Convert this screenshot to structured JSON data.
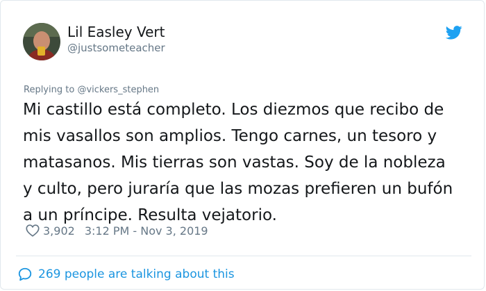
{
  "user": {
    "display_name": "Lil Easley Vert",
    "handle": "@justsometeacher"
  },
  "tweet": {
    "reply_prefix": "Replying to ",
    "reply_to": "@vickers_stephen",
    "lines": [
      "Mi castillo está completo. Los diezmos que recibo de",
      "mis vasallos son amplios. Tengo carnes, un tesoro y",
      "matasanos. Mis tierras son vastas. Soy de la nobleza",
      "y culto, pero juraría que las mozas prefieren un bufón",
      "a un príncipe. Resulta vejatorio."
    ],
    "likes": "3,902",
    "timestamp": "3:12 PM - Nov 3, 2019"
  },
  "footer": {
    "talking": "269 people are talking about this"
  },
  "icons": {
    "brand": "twitter-bird-icon",
    "like": "heart-icon",
    "talk": "speech-bubble-icon"
  },
  "colors": {
    "accent": "#1b95e0",
    "secondary_text": "#657786",
    "primary_text": "#14171a",
    "border": "#e1e8ed"
  }
}
